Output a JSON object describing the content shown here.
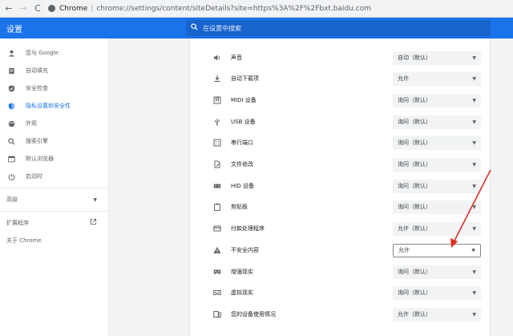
{
  "browser": {
    "back": "←",
    "forward": "→",
    "reload": "C",
    "host": "Chrome",
    "separator": "|",
    "url": "chrome://settings/content/siteDetails?site=https%3A%2F%2Fbxt.baidu.com"
  },
  "header": {
    "title": "设置",
    "search_placeholder": "在设置中搜索"
  },
  "sidebar": {
    "items": [
      {
        "label": "您与 Google",
        "icon": "person-icon"
      },
      {
        "label": "自动填充",
        "icon": "autofill-icon"
      },
      {
        "label": "安全检查",
        "icon": "shield-icon"
      },
      {
        "label": "隐私设置和安全性",
        "icon": "privacy-shield-icon",
        "active": true
      },
      {
        "label": "外观",
        "icon": "palette-icon"
      },
      {
        "label": "搜索引擎",
        "icon": "search-icon"
      },
      {
        "label": "默认浏览器",
        "icon": "browser-icon"
      },
      {
        "label": "启动时",
        "icon": "power-icon"
      }
    ],
    "advanced_label": "高级",
    "extensions_label": "扩展程序",
    "about_label": "关于 Chrome"
  },
  "permissions": [
    {
      "label": "声音",
      "value": "自动（默认）",
      "icon": "sound-icon"
    },
    {
      "label": "自动下载项",
      "value": "允许",
      "icon": "download-icon"
    },
    {
      "label": "MIDI 设备",
      "value": "询问（默认）",
      "icon": "midi-icon"
    },
    {
      "label": "USB 设备",
      "value": "询问（默认）",
      "icon": "usb-icon"
    },
    {
      "label": "串行端口",
      "value": "询问（默认）",
      "icon": "serial-port-icon"
    },
    {
      "label": "文件修改",
      "value": "询问（默认）",
      "icon": "file-edit-icon"
    },
    {
      "label": "HID 设备",
      "value": "询问（默认）",
      "icon": "hid-icon"
    },
    {
      "label": "剪贴板",
      "value": "询问（默认）",
      "icon": "clipboard-icon"
    },
    {
      "label": "付款处理程序",
      "value": "允许（默认）",
      "icon": "payment-icon"
    },
    {
      "label": "不安全内容",
      "value": "允许",
      "icon": "warning-icon",
      "highlight": true
    },
    {
      "label": "增强现实",
      "value": "询问（默认）",
      "icon": "ar-icon"
    },
    {
      "label": "虚拟现实",
      "value": "询问（默认）",
      "icon": "vr-icon"
    },
    {
      "label": "您的设备使用情况",
      "value": "允许（默认）",
      "icon": "device-usage-icon"
    }
  ],
  "colors": {
    "accent": "#1a73e8",
    "annotation_arrow": "#d93025"
  }
}
